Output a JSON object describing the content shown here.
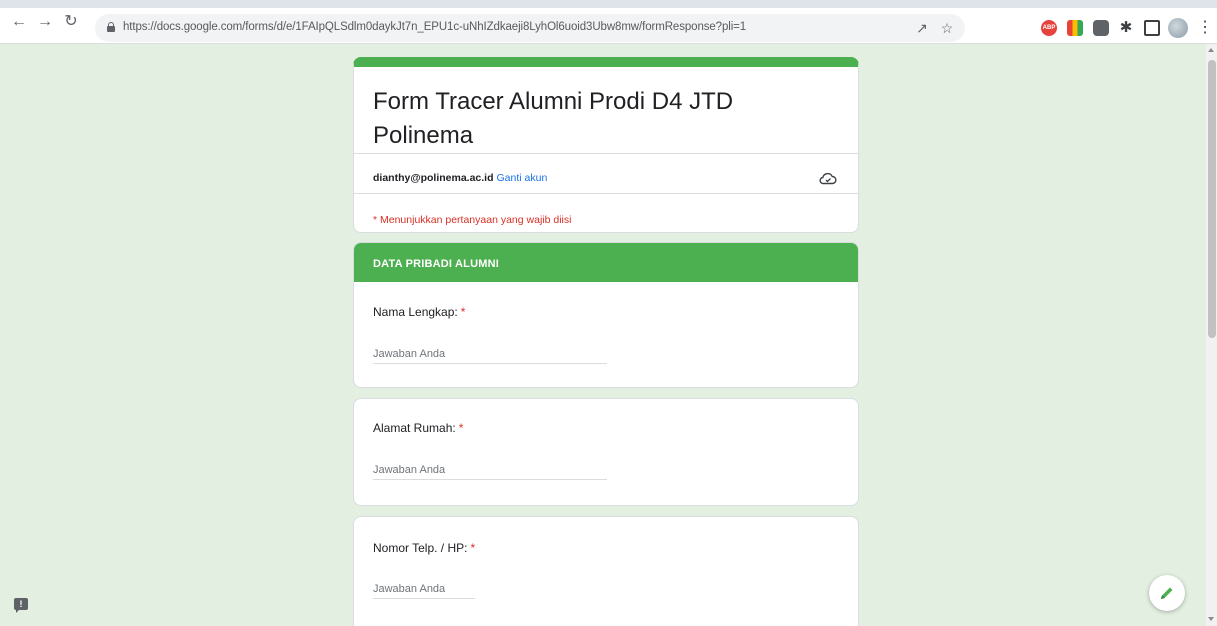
{
  "browser": {
    "url": "https://docs.google.com/forms/d/e/1FAIpQLSdlm0daykJt7n_EPU1c-uNhIZdkaeji8LyhOl6uoid3Ubw8mw/formResponse?pli=1",
    "icons": [
      "back-arrow-icon",
      "forward-arrow-icon",
      "reload-icon",
      "lock-icon",
      "share-icon",
      "star-icon",
      "adblock-extension-icon",
      "bars-extension-icon",
      "extension-icon",
      "puzzle-icon",
      "side-panel-icon",
      "profile-avatar-icon",
      "menu-dots-icon"
    ]
  },
  "form": {
    "title": "Form Tracer Alumni Prodi D4 JTD Polinema",
    "account_email": "dianthy@polinema.ac.id",
    "switch_account": "Ganti akun",
    "required_note": "* Menunjukkan pertanyaan yang wajib diisi",
    "section_title": "DATA PRIBADI ALUMNI",
    "required_marker": "*",
    "questions": [
      {
        "label": "Nama Lengkap:",
        "placeholder": "Jawaban Anda"
      },
      {
        "label": "Alamat Rumah:",
        "placeholder": "Jawaban Anda"
      },
      {
        "label": "Nomor Telp. / HP:",
        "placeholder": "Jawaban Anda"
      }
    ]
  },
  "colors": {
    "theme": "#4caf50",
    "background": "#e3f0e1",
    "required": "#d93025",
    "link": "#1a73e8"
  },
  "floating": {
    "feedback_icon": "!",
    "edit_icon": "pencil-icon"
  }
}
